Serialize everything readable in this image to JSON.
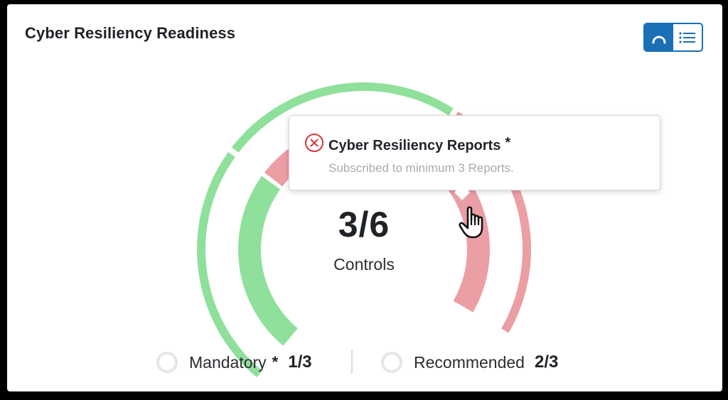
{
  "card": {
    "title": "Cyber Resiliency Readiness"
  },
  "view_toggle": {
    "options": [
      {
        "icon": "gauge-icon",
        "active": true
      },
      {
        "icon": "list-icon",
        "active": false
      }
    ],
    "accent_color": "#1a6fb6"
  },
  "gauge": {
    "value": "3/6",
    "label": "Controls",
    "colors": {
      "pass": "#8fe09b",
      "fail": "#ec9ea5"
    },
    "outer_ring": [
      {
        "status": "pass"
      },
      {
        "status": "pass"
      },
      {
        "status": "fail"
      }
    ],
    "inner_ring": [
      {
        "status": "pass"
      },
      {
        "status": "fail"
      },
      {
        "status": "fail"
      }
    ]
  },
  "tooltip": {
    "icon": "error-circle-icon",
    "title": "Cyber Resiliency Reports",
    "marker": "*",
    "description": "Subscribed to minimum 3 Reports."
  },
  "legend": {
    "mandatory": {
      "label": "Mandatory",
      "marker": "*",
      "value": "1/3"
    },
    "recommended": {
      "label": "Recommended",
      "value": "2/3"
    }
  }
}
